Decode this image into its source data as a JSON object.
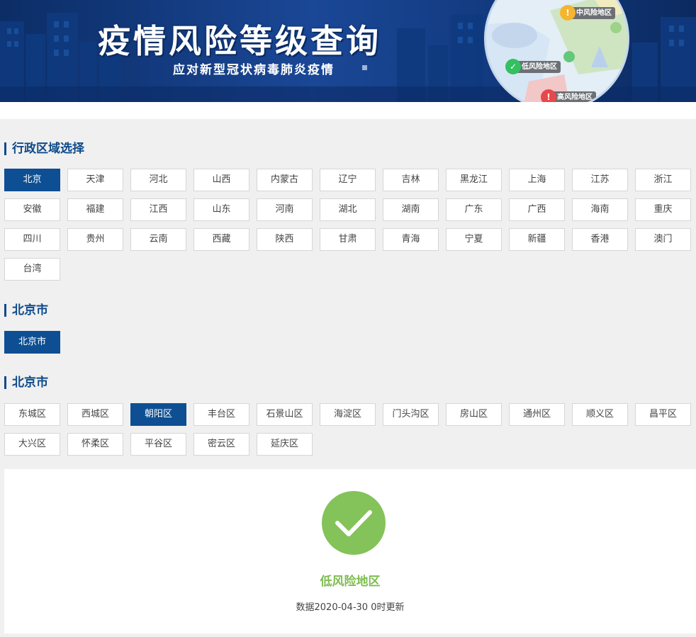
{
  "banner": {
    "title": "疫情风险等级查询",
    "subtitle": "应对新型冠状病毒肺炎疫情",
    "map_tags": {
      "medium": "中风险地区",
      "low": "低风险地区",
      "high": "高风险地区"
    },
    "colors": {
      "medium": "#f5b530",
      "low": "#32c060",
      "high": "#e8474b"
    }
  },
  "provinces": {
    "title": "行政区域选择",
    "selected": "北京",
    "items": [
      "北京",
      "天津",
      "河北",
      "山西",
      "内蒙古",
      "辽宁",
      "吉林",
      "黑龙江",
      "上海",
      "江苏",
      "浙江",
      "安徽",
      "福建",
      "江西",
      "山东",
      "河南",
      "湖北",
      "湖南",
      "广东",
      "广西",
      "海南",
      "重庆",
      "四川",
      "贵州",
      "云南",
      "西藏",
      "陕西",
      "甘肃",
      "青海",
      "宁夏",
      "新疆",
      "香港",
      "澳门",
      "台湾"
    ]
  },
  "cities": {
    "title": "北京市",
    "selected": "北京市",
    "items": [
      "北京市"
    ]
  },
  "districts": {
    "title": "北京市",
    "selected": "朝阳区",
    "items": [
      "东城区",
      "西城区",
      "朝阳区",
      "丰台区",
      "石景山区",
      "海淀区",
      "门头沟区",
      "房山区",
      "通州区",
      "顺义区",
      "昌平区",
      "大兴区",
      "怀柔区",
      "平谷区",
      "密云区",
      "延庆区"
    ]
  },
  "result": {
    "icon": "checkmark-icon",
    "level": "低风险地区",
    "update_text": "数据2020-04-30 0时更新",
    "color": "#84c25a"
  },
  "theme": {
    "accent": "#0d4f92"
  }
}
